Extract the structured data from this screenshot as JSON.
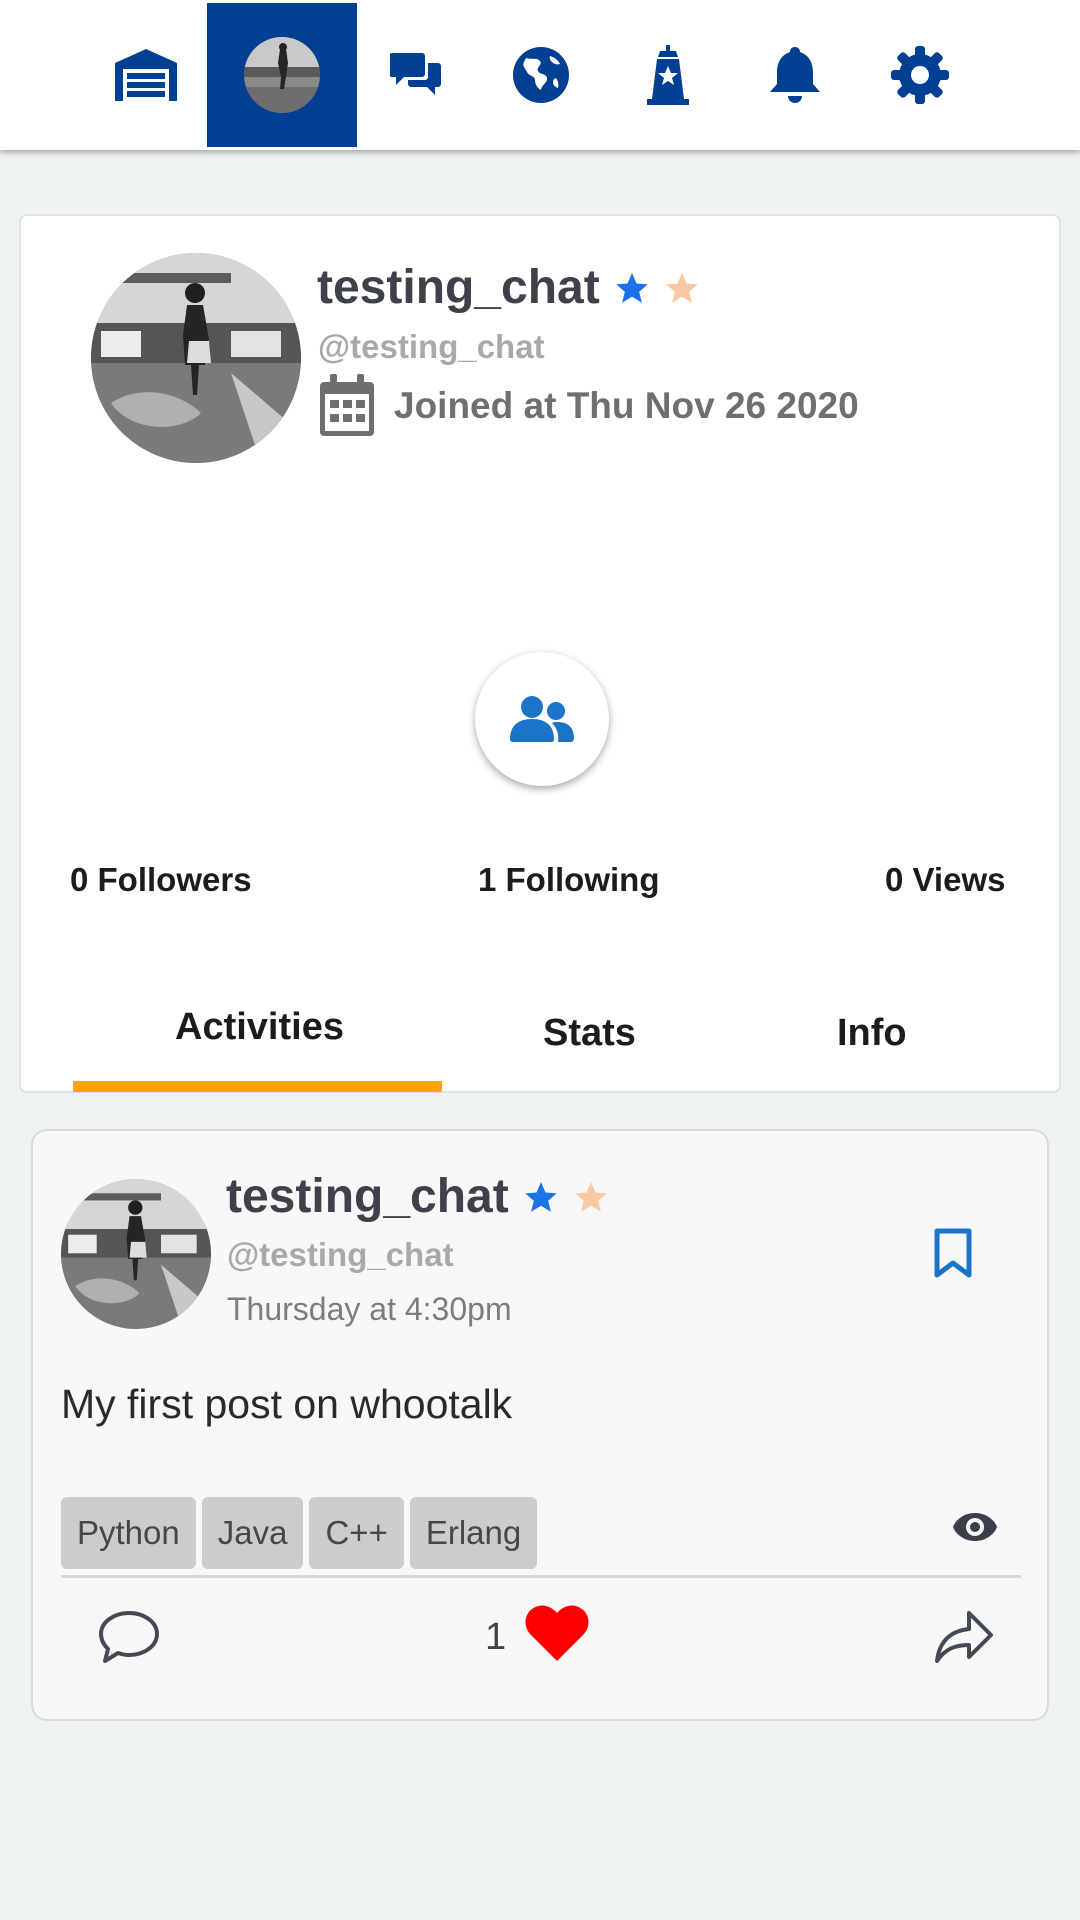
{
  "nav": {
    "items": [
      {
        "icon": "garage-icon",
        "label": "home"
      },
      {
        "icon": "profile-avatar",
        "label": "profile"
      },
      {
        "icon": "chat-bubbles-icon",
        "label": "chats"
      },
      {
        "icon": "globe-icon",
        "label": "explore"
      },
      {
        "icon": "lighthouse-icon",
        "label": "featured"
      },
      {
        "icon": "bell-icon",
        "label": "notifications"
      },
      {
        "icon": "gear-icon",
        "label": "settings"
      }
    ],
    "active_index": 1,
    "active_color": "#003f91",
    "icon_color": "#003f91"
  },
  "profile": {
    "username": "testing_chat",
    "handle": "@testing_chat",
    "joined": "Joined at Thu Nov 26 2020",
    "badges": [
      {
        "icon": "star-icon",
        "color": "#1a73e8"
      },
      {
        "icon": "star-icon",
        "color": "#f9c9a3"
      }
    ],
    "follow_icon": "users-icon",
    "stats": {
      "followers": "0 Followers",
      "following": "1 Following",
      "views": "0 Views"
    },
    "tabs": [
      {
        "label": "Activities",
        "active": true
      },
      {
        "label": "Stats",
        "active": false
      },
      {
        "label": "Info",
        "active": false
      }
    ],
    "tab_accent": "#ffa500"
  },
  "post": {
    "username": "testing_chat",
    "handle": "@testing_chat",
    "time": "Thursday at 4:30pm",
    "text": "My first post on whootalk",
    "tags": [
      "Python",
      "Java",
      "C++",
      "Erlang"
    ],
    "likes": "1",
    "like_color": "#ff0000"
  }
}
